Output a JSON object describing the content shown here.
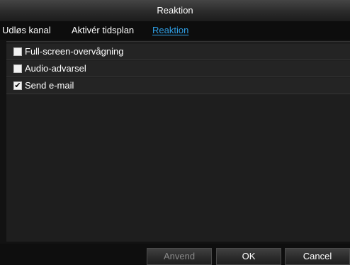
{
  "window": {
    "title": "Reaktion"
  },
  "tabs": [
    {
      "label": "Udløs kanal",
      "active": false
    },
    {
      "label": "Aktivér tidsplan",
      "active": false
    },
    {
      "label": "Reaktion",
      "active": true
    }
  ],
  "options": [
    {
      "label": "Full-screen-overvågning",
      "checked": false
    },
    {
      "label": "Audio-advarsel",
      "checked": false
    },
    {
      "label": "Send e-mail",
      "checked": true
    }
  ],
  "checkmark_glyph": "✔",
  "buttons": {
    "apply": {
      "label": "Anvend",
      "enabled": false
    },
    "ok": {
      "label": "OK",
      "enabled": true
    },
    "cancel": {
      "label": "Cancel",
      "enabled": true
    }
  },
  "colors": {
    "active_tab": "#2f9fe6",
    "background": "#121212"
  }
}
